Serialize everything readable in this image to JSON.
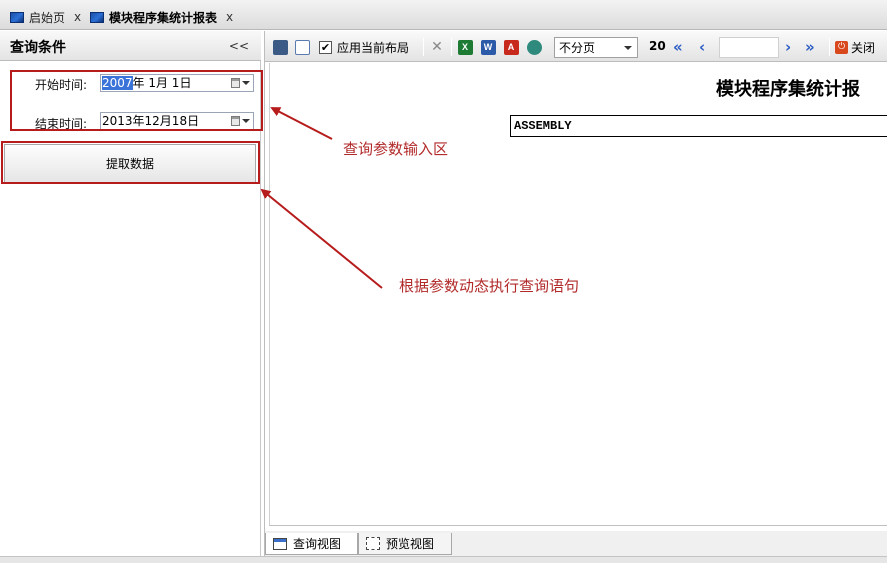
{
  "doc_tabs": {
    "home": {
      "label": "启始页",
      "close": "x"
    },
    "report": {
      "label": "模块程序集统计报表",
      "close": "x"
    }
  },
  "query_panel": {
    "title": "查询条件",
    "collapse": "<<",
    "start_label": "开始时间:",
    "start_year_selected": "2007",
    "start_rest": "年  1月  1日",
    "end_label": "结束时间:",
    "end_value": "2013年12月18日",
    "fetch_button": "提取数据"
  },
  "toolbar": {
    "apply_layout_label": "应用当前布局",
    "apply_layout_checked": true,
    "paging_mode": "不分页",
    "page_size": "20",
    "close_label": "关闭"
  },
  "report": {
    "title": "模块程序集统计报",
    "cell": "ASSEMBLY"
  },
  "view_tabs": {
    "query_view": "查询视图",
    "preview_view": "预览视图"
  },
  "annotations": {
    "input_area": "查询参数输入区",
    "dynamic_query": "根据参数动态执行查询语句"
  },
  "colors": {
    "annotation_red": "#b71c1c",
    "selection_blue": "#3a74d8",
    "nav_blue": "#2b5cc4"
  }
}
